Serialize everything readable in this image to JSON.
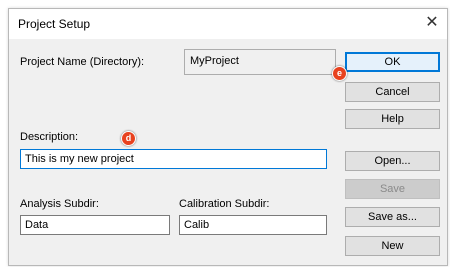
{
  "window": {
    "title": "Project Setup",
    "close_glyph": "✕"
  },
  "fields": {
    "project_name_label": "Project Name (Directory):",
    "project_name_value": "MyProject",
    "description_label": "Description:",
    "description_value": "This is my new project",
    "analysis_label": "Analysis Subdir:",
    "analysis_value": "Data",
    "calibration_label": "Calibration Subdir:",
    "calibration_value": "Calib"
  },
  "buttons": {
    "ok": "OK",
    "cancel": "Cancel",
    "help": "Help",
    "open": "Open...",
    "save": "Save",
    "save_as": "Save as...",
    "new": "New"
  },
  "markers": {
    "e": "e",
    "d": "d"
  },
  "colors": {
    "accent": "#0078d7",
    "marker": "#e8421f"
  }
}
